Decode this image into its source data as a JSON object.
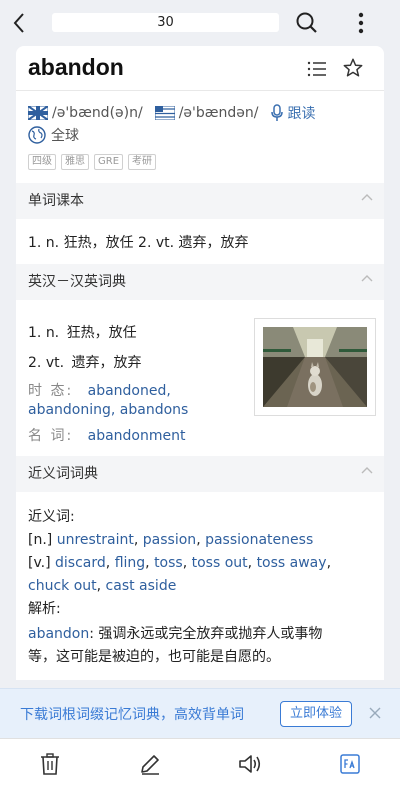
{
  "search": {
    "value": "30"
  },
  "word": {
    "headword": "abandon",
    "uk_phonetic": "/ə'bænd(ə)n/",
    "us_phonetic": "/ə'bændən/",
    "follow_read": "跟读",
    "global": "全球",
    "tags": [
      "四级",
      "雅思",
      "GRE",
      "考研"
    ]
  },
  "sections": {
    "book": {
      "title": "单词课本",
      "definition": "1. n. 狂热，放任 2. vt. 遗弃，放弃"
    },
    "dict": {
      "title": "英汉－汉英词典",
      "defs": [
        {
          "num": "1.",
          "pos": "n.",
          "text": "狂热，放任"
        },
        {
          "num": "2.",
          "pos": "vt.",
          "text": "遗弃，放弃"
        }
      ],
      "tense_label": "时 态:",
      "tense_forms_1": "abandoned,",
      "tense_forms_2": "abandoning, abandons",
      "noun_label": "名 词:",
      "noun_form": "abandonment"
    },
    "syn": {
      "title": "近义词词典",
      "syn_label": "近义词:",
      "n_tag": "[n.]",
      "n_words": [
        "unrestraint",
        "passion",
        "passionateness"
      ],
      "v_tag": "[v.]",
      "v_words_line1": [
        "discard",
        "fling",
        "toss",
        "toss out",
        "toss away"
      ],
      "v_words_line2": [
        "chuck out",
        "cast aside"
      ],
      "analysis_label": "解析:",
      "analysis_word": "abandon",
      "analysis_text_1": ": 强调永远或完全放弃或抛弃人或事物",
      "analysis_text_2": "等，这可能是被迫的，也可能是自愿的。"
    }
  },
  "promo": {
    "text": "下载词根词缀记忆词典，高效背单词",
    "button": "立即体验"
  },
  "colors": {
    "accent": "#3a7bd5",
    "link": "#2f5f9e"
  }
}
